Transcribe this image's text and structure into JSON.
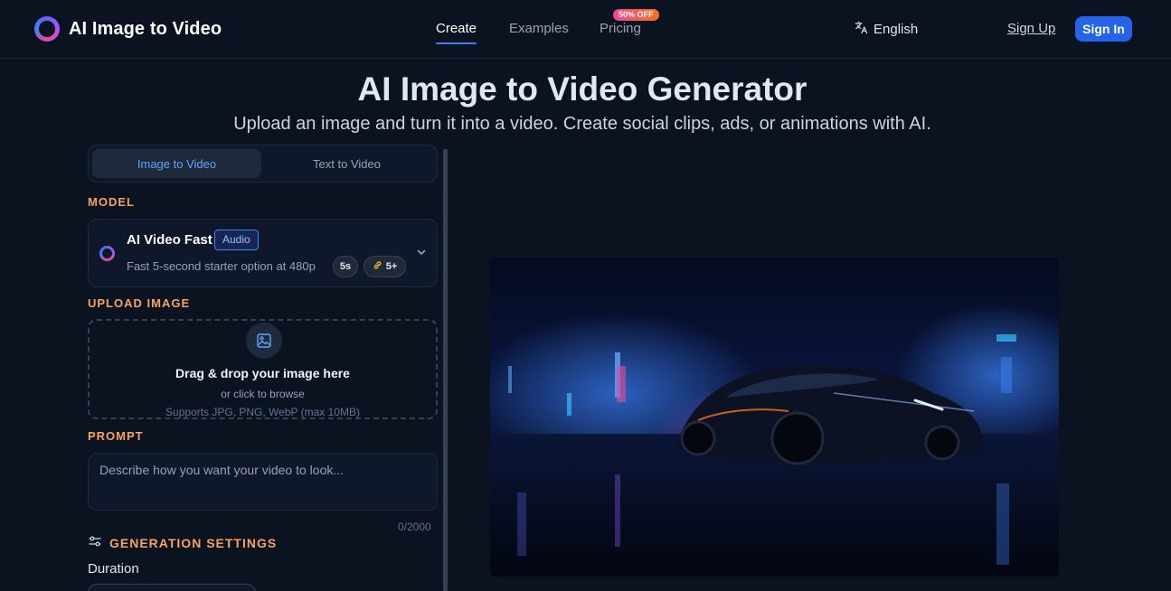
{
  "app": {
    "title": "AI Image to Video"
  },
  "nav": {
    "items": [
      {
        "label": "Create",
        "active": true
      },
      {
        "label": "Examples",
        "active": false
      },
      {
        "label": "Pricing",
        "active": false,
        "badge": "50% OFF"
      }
    ]
  },
  "header": {
    "language": "English",
    "language_icon": "translate-icon",
    "sign_up": "Sign Up",
    "sign_in": "Sign In"
  },
  "hero": {
    "title": "AI Image to Video Generator",
    "subtitle": "Upload an image and turn it into a video. Create social clips, ads, or animations with AI."
  },
  "mode_tabs": [
    {
      "label": "Image to Video",
      "active": true
    },
    {
      "label": "Text to Video",
      "active": false
    }
  ],
  "model": {
    "section_label": "MODEL",
    "name": "AI Video Fast",
    "tag": "Audio",
    "description": "Fast 5-second starter option at 480p",
    "duration": "5s",
    "credits": "5+",
    "icon": "model-ring-icon"
  },
  "upload": {
    "section_label": "UPLOAD IMAGE",
    "title": "Drag & drop your image here",
    "subtitle": "or click to browse",
    "hint": "Supports JPG, PNG, WebP (max 10MB)",
    "icon": "image-upload-icon"
  },
  "prompt": {
    "section_label": "PROMPT",
    "placeholder": "Describe how you want your video to look...",
    "value": "",
    "char_count": "0/2000"
  },
  "settings": {
    "section_label": "GENERATION SETTINGS",
    "duration_label": "Duration"
  },
  "colors": {
    "background": "#0b1220",
    "accent": "#2563eb",
    "section_label": "#f4a460",
    "badge_gradient": [
      "#ec4899",
      "#f97316"
    ]
  }
}
